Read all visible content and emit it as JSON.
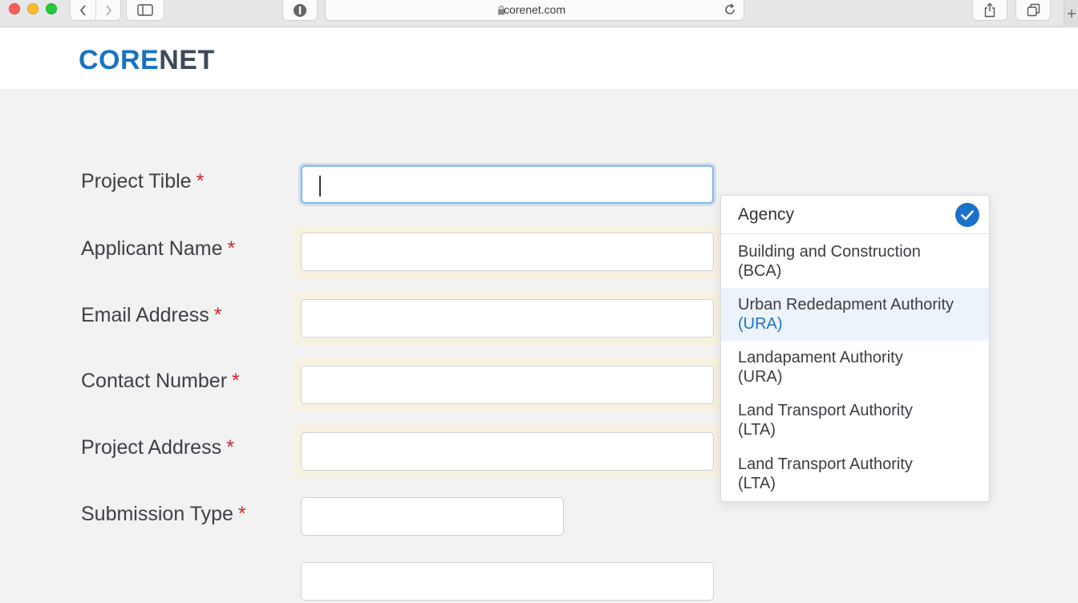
{
  "browser": {
    "url": "corenet.com"
  },
  "site": {
    "logo_part1": "CORE",
    "logo_part2": "NET"
  },
  "form": {
    "fields": [
      {
        "label": "Project Tible",
        "required": "*",
        "value": ""
      },
      {
        "label": "Applicant Name",
        "required": "*",
        "value": ""
      },
      {
        "label": "Email Address",
        "required": "*",
        "value": ""
      },
      {
        "label": "Contact Number",
        "required": "*",
        "value": ""
      },
      {
        "label": "Project Address",
        "required": "*",
        "value": ""
      },
      {
        "label": "Submission Type",
        "required": "*",
        "value": ""
      }
    ]
  },
  "dropdown": {
    "header": "Agency",
    "options": [
      {
        "name": "Building and Construction",
        "code": "(BCA)"
      },
      {
        "name": "Urban Rededapment Authority",
        "code": "(URA)"
      },
      {
        "name": "Landapament Authority",
        "code": "(URA)"
      },
      {
        "name": "Land Transport Authority",
        "code": "(LTA)"
      },
      {
        "name": "Land Transport Authority",
        "code": "(LTA)"
      }
    ],
    "highlighted_index": 1
  },
  "colors": {
    "brand_blue": "#1972c0",
    "brand_dark": "#3c4a5a",
    "required_red": "#d0252d",
    "focus_blue": "#86b9e6",
    "autofill_bg": "#f7f1e2"
  }
}
